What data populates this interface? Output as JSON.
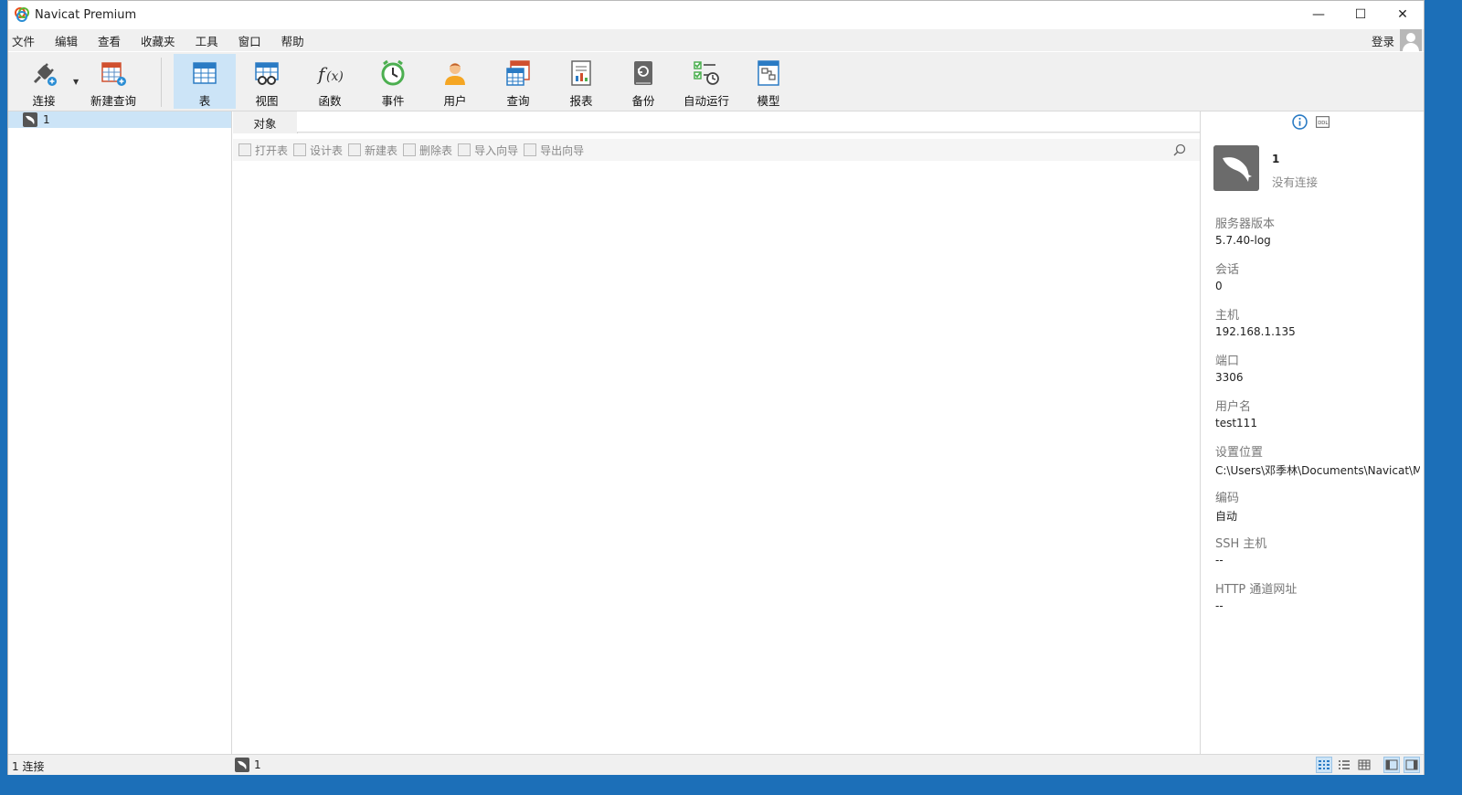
{
  "window": {
    "title": "Navicat Premium",
    "controls": {
      "minimize": "—",
      "maximize": "☐",
      "close": "✕"
    }
  },
  "menu": {
    "items": [
      "文件",
      "编辑",
      "查看",
      "收藏夹",
      "工具",
      "窗口",
      "帮助"
    ],
    "login": "登录"
  },
  "toolbar": {
    "buttons": [
      {
        "label": "连接",
        "icon": "connect-icon"
      },
      {
        "label": "新建查询",
        "icon": "new-query-icon"
      },
      {
        "label": "表",
        "icon": "table-icon",
        "active": true
      },
      {
        "label": "视图",
        "icon": "view-icon"
      },
      {
        "label": "函数",
        "icon": "function-icon"
      },
      {
        "label": "事件",
        "icon": "event-icon"
      },
      {
        "label": "用户",
        "icon": "user-icon"
      },
      {
        "label": "查询",
        "icon": "query-icon"
      },
      {
        "label": "报表",
        "icon": "report-icon"
      },
      {
        "label": "备份",
        "icon": "backup-icon"
      },
      {
        "label": "自动运行",
        "icon": "automation-icon"
      },
      {
        "label": "模型",
        "icon": "model-icon"
      }
    ]
  },
  "sidebar": {
    "connections": [
      {
        "name": "1",
        "selected": true
      }
    ]
  },
  "main": {
    "tab_label": "对象",
    "object_toolbar": [
      "打开表",
      "设计表",
      "新建表",
      "删除表",
      "导入向导",
      "导出向导"
    ]
  },
  "info": {
    "name": "1",
    "status": "没有连接",
    "properties": [
      {
        "label": "服务器版本",
        "value": "5.7.40-log"
      },
      {
        "label": "会话",
        "value": "0"
      },
      {
        "label": "主机",
        "value": "192.168.1.135"
      },
      {
        "label": "端口",
        "value": "3306"
      },
      {
        "label": "用户名",
        "value": "test111"
      },
      {
        "label": "设置位置",
        "value": "C:\\Users\\邓季林\\Documents\\Navicat\\M"
      },
      {
        "label": "编码",
        "value": "自动"
      },
      {
        "label": "SSH 主机",
        "value": "--"
      },
      {
        "label": "HTTP 通道网址",
        "value": "--"
      }
    ]
  },
  "status": {
    "left": "1 连接",
    "middle": "1"
  },
  "colors": {
    "accent": "#cce4f7",
    "desktop": "#1c6fb8",
    "panel": "#f0f0f0"
  }
}
